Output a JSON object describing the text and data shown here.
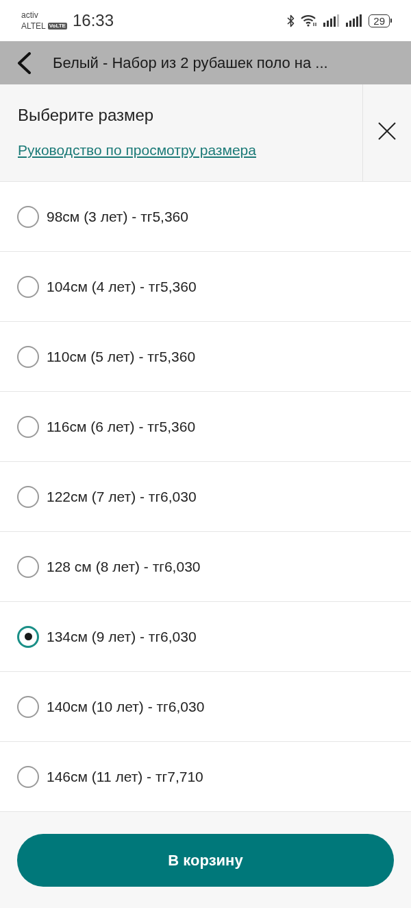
{
  "status_bar": {
    "carrier": "activ",
    "network": "ALTEL",
    "volte_badge": "VoLTE",
    "time": "16:33",
    "battery": "29"
  },
  "app_bar": {
    "title": "Белый - Набор из 2 рубашек поло на ..."
  },
  "sheet": {
    "title": "Выберите размер",
    "size_guide_link": "Руководство по просмотру размера"
  },
  "sizes": [
    {
      "label": "98см (3 лет) - тг5,360",
      "selected": false
    },
    {
      "label": "104см (4 лет) - тг5,360",
      "selected": false
    },
    {
      "label": "110см (5 лет) - тг5,360",
      "selected": false
    },
    {
      "label": "116см (6 лет) - тг5,360",
      "selected": false
    },
    {
      "label": "122см (7 лет) - тг6,030",
      "selected": false
    },
    {
      "label": "128 см (8 лет) - тг6,030",
      "selected": false
    },
    {
      "label": "134см (9 лет) - тг6,030",
      "selected": true
    },
    {
      "label": "140см (10 лет) - тг6,030",
      "selected": false
    },
    {
      "label": "146см (11 лет) - тг7,710",
      "selected": false
    }
  ],
  "add_to_cart_button": "В корзину"
}
